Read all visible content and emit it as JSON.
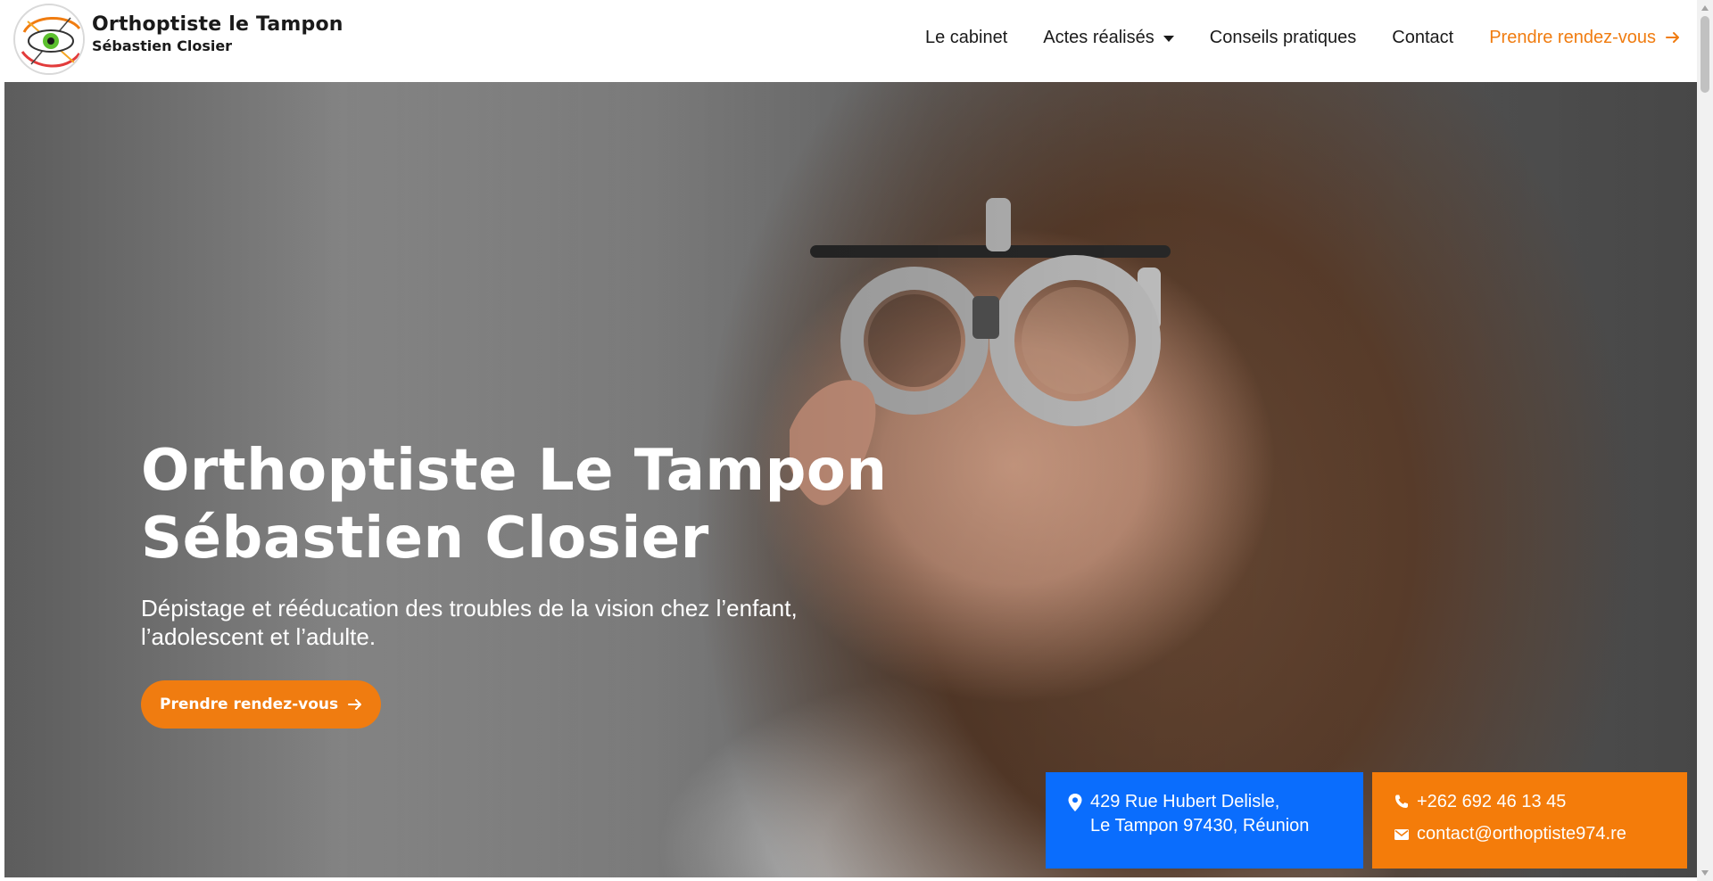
{
  "site": {
    "title": "Orthoptiste le Tampon",
    "subtitle": "Sébastien Closier"
  },
  "nav": {
    "items": [
      {
        "label": "Le cabinet"
      },
      {
        "label": "Actes réalisés",
        "has_dropdown": true
      },
      {
        "label": "Conseils pratiques"
      },
      {
        "label": "Contact"
      }
    ],
    "cta_label": "Prendre rendez-vous"
  },
  "hero": {
    "title_line1": "Orthoptiste Le Tampon",
    "title_line2": "Sébastien Closier",
    "subtitle": "Dépistage et rééducation des troubles de la vision chez l’enfant, l’adolescent et l’adulte.",
    "button_label": "Prendre rendez-vous"
  },
  "contact": {
    "address_line1": "429 Rue Hubert Delisle,",
    "address_line2": "Le Tampon 97430, Réunion",
    "phone": "+262 692 46 13 45",
    "email": "contact@orthoptiste974.re"
  },
  "colors": {
    "accent": "#f07c10",
    "blue": "#0a6dfd",
    "text": "#1a1a1a"
  },
  "icons": [
    "map-pin-icon",
    "phone-icon",
    "mail-icon",
    "arrow-right-icon",
    "chevron-down-icon",
    "eye-logo-icon"
  ]
}
